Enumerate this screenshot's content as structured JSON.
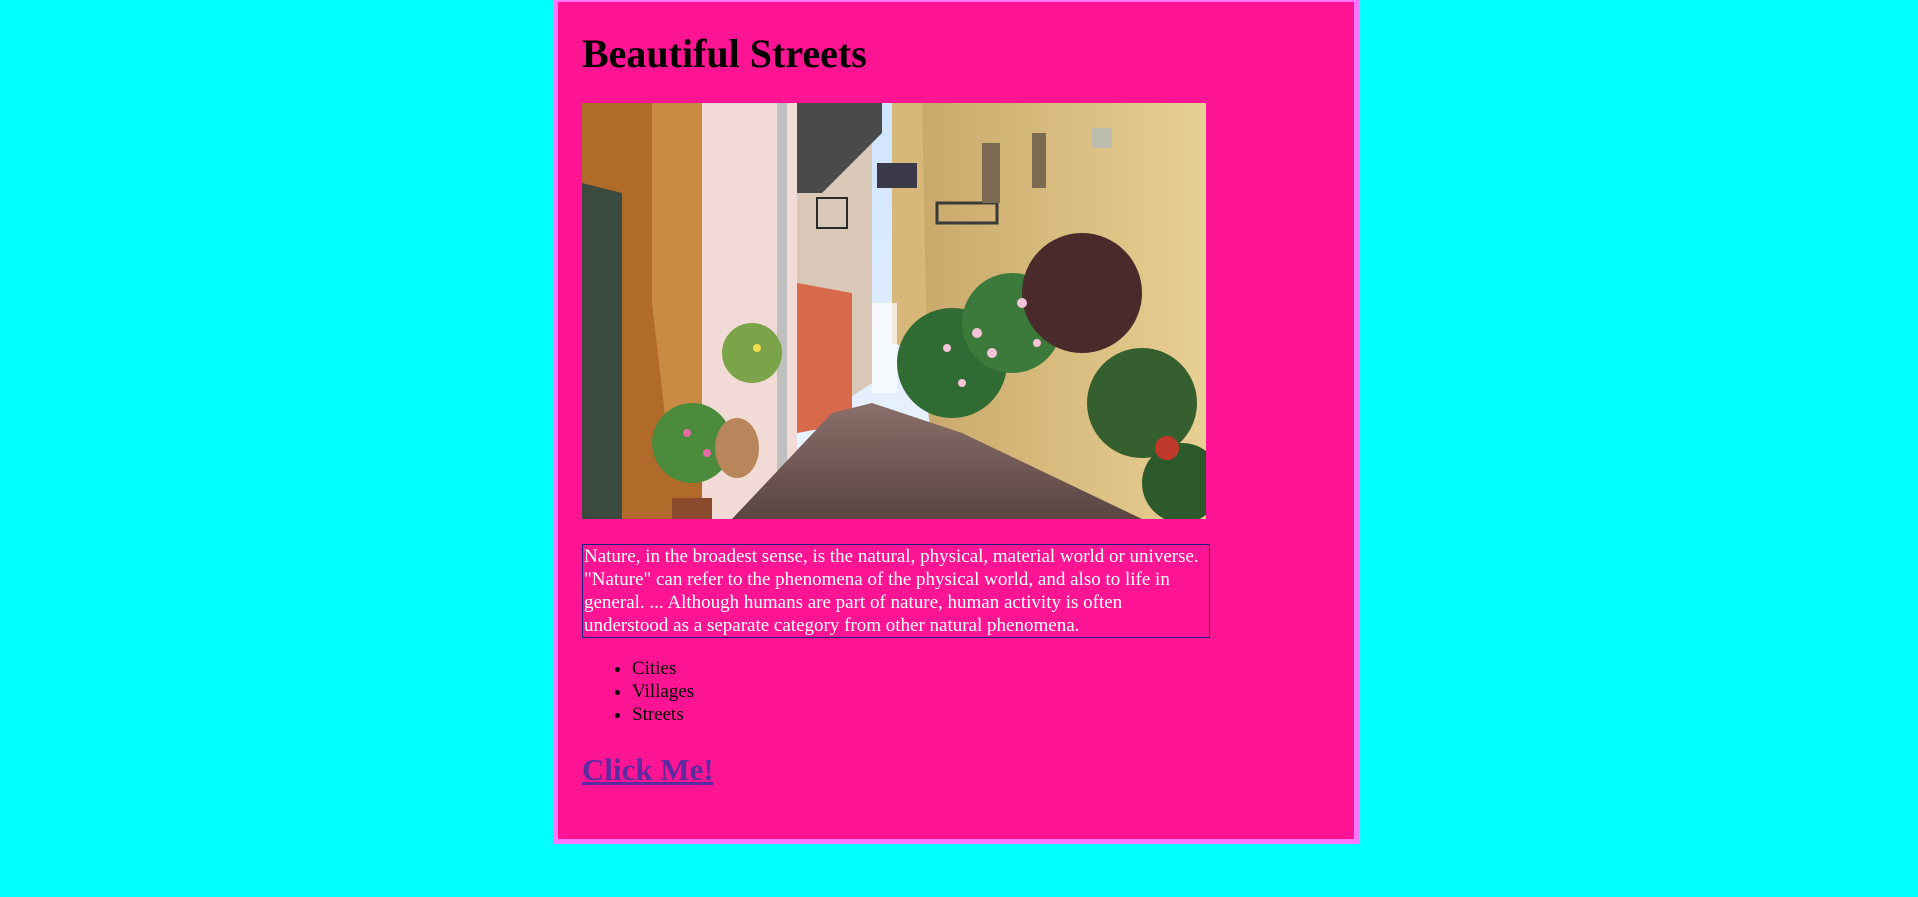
{
  "page": {
    "background_color": "#00ffff",
    "card_color": "#ff1493",
    "card_border_color": "#ff77ff"
  },
  "heading": "Beautiful Streets",
  "image": {
    "alt": "Narrow cobbled street between pastel buildings with flowers"
  },
  "description": "Nature, in the broadest sense, is the natural, physical, material world or universe. \"Nature\" can refer to the phenomena of the physical world, and also to life in general. ... Although humans are part of nature, human activity is often understood as a separate category from other natural phenomena.",
  "list": [
    "Cities",
    "Villages",
    "Streets"
  ],
  "link": {
    "label": "Click Me!",
    "color": "#5b2ca0"
  }
}
